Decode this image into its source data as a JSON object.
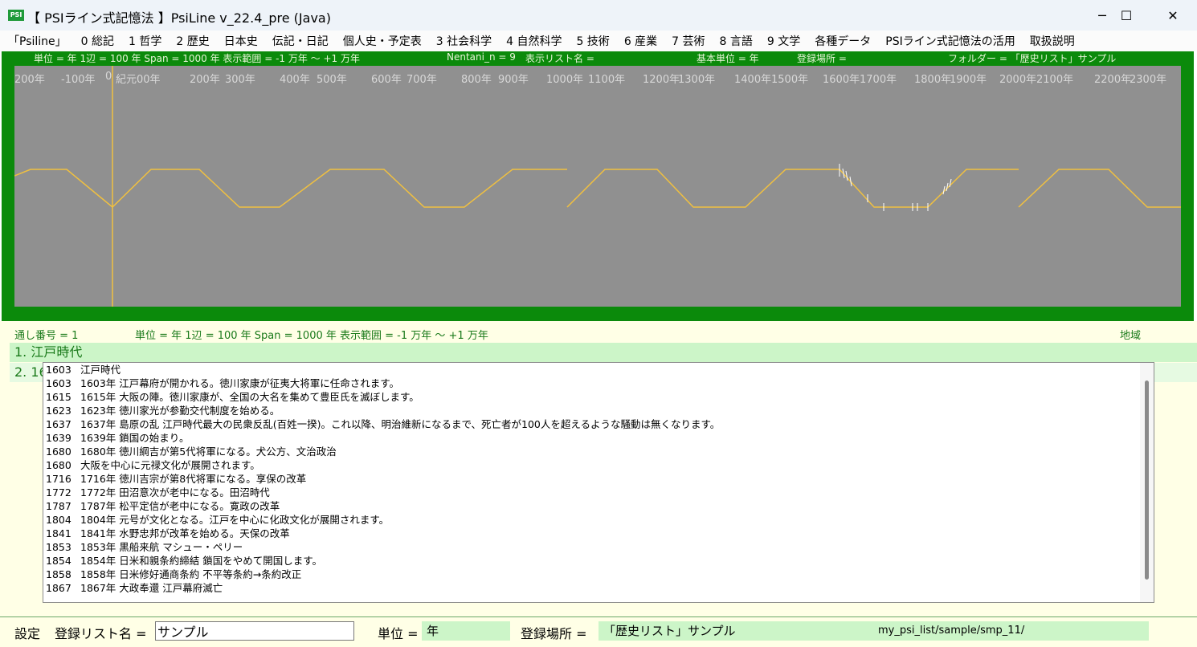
{
  "window": {
    "title": "【 PSIライン式記憶法 】PsiLine v_22.4_pre (Java)",
    "icon_label": "PSI",
    "minimize": "─",
    "maximize": "☐",
    "close": "✕"
  },
  "menu": [
    "「Psiline」",
    "0 総記",
    "1 哲学",
    "2 歴史",
    "日本史",
    "伝記・日記",
    "個人史・予定表",
    "3 社会科学",
    "4 自然科学",
    "5 技術",
    "6 産業",
    "7 芸術",
    "8 言語",
    "9 文学",
    "各種データ",
    "PSIライン式記憶法の活用",
    "取扱説明"
  ],
  "header_info": {
    "unit": "単位 = 年  1辺 = 100 年  Span = 1000 年  表示範囲 = -1 万年 〜 +1 万年",
    "nentani": "Nentani_n = 9",
    "list_name": "表示リスト名 =",
    "base_unit": "基本単位 = 年",
    "place": "登録場所 =",
    "folder": "フォルダー = 「歴史リスト」サンプル"
  },
  "axis_labels": [
    "200年",
    "-100年",
    "0",
    "紀元00年",
    "200年",
    "300年",
    "400年",
    "500年",
    "600年",
    "700年",
    "800年",
    "900年",
    "1000年",
    "1100年",
    "1200年",
    "1300年",
    "1400年",
    "1500年",
    "1600年",
    "1700年",
    "1800年",
    "1900年",
    "2000年",
    "2100年",
    "2200年",
    "2300年"
  ],
  "status": {
    "serial": "通し番号 = 1",
    "unit": "単位 = 年  1辺 = 100 年  Span = 1000 年  表示範囲 = -1 万年 〜 +1 万年",
    "region": "地域"
  },
  "rows": {
    "row1": "1. 江戸時代",
    "row2": "2. 16"
  },
  "entries": [
    {
      "year": "1603",
      "text": "江戸時代"
    },
    {
      "year": "1603",
      "text": "1603年 江戸幕府が開かれる。徳川家康が征夷大将軍に任命されます。"
    },
    {
      "year": "1615",
      "text": "1615年 大阪の陣。徳川家康が、全国の大名を集めて豊臣氏を滅ぼします。"
    },
    {
      "year": "1623",
      "text": "1623年 徳川家光が参勤交代制度を始める。"
    },
    {
      "year": "1637",
      "text": "1637年 島原の乱 江戸時代最大の民衆反乱(百姓一揆)。これ以降、明治維新になるまで、死亡者が100人を超えるような騒動は無くなります。"
    },
    {
      "year": "1639",
      "text": "1639年 鎖国の始まり。"
    },
    {
      "year": "1680",
      "text": "1680年 徳川綱吉が第5代将軍になる。犬公方、文治政治"
    },
    {
      "year": "1680",
      "text": "大阪を中心に元禄文化が展開されます。"
    },
    {
      "year": "1716",
      "text": "1716年 徳川吉宗が第8代将軍になる。享保の改革"
    },
    {
      "year": "1772",
      "text": "1772年 田沼意次が老中になる。田沼時代"
    },
    {
      "year": "1787",
      "text": "1787年 松平定信が老中になる。寛政の改革"
    },
    {
      "year": "1804",
      "text": "1804年 元号が文化となる。江戸を中心に化政文化が展開されます。"
    },
    {
      "year": "1841",
      "text": "1841年 水野忠邦が改革を始める。天保の改革"
    },
    {
      "year": "1853",
      "text": "1853年 黒船来航 マシュー・ペリー"
    },
    {
      "year": "1854",
      "text": "1854年 日米和親条約締結 鎖国をやめて開国します。"
    },
    {
      "year": "1858",
      "text": "1858年 日米修好通商条約 不平等条約→条約改正"
    },
    {
      "year": "1867",
      "text": "1867年 大政奉還 江戸幕府滅亡"
    }
  ],
  "bottom": {
    "settings": "設定",
    "list_name_label": "登録リスト名 =",
    "list_name_value": "サンプル",
    "unit_label": "単位 =",
    "unit_value": "年",
    "place_label": "登録場所 =",
    "place_value": "「歴史リスト」サンプル",
    "path_value": "my_psi_list/sample/smp_11/"
  },
  "colors": {
    "frame_green": "#0b8a0b",
    "plot_gray": "#909090",
    "line_yellow": "#f0c040"
  }
}
